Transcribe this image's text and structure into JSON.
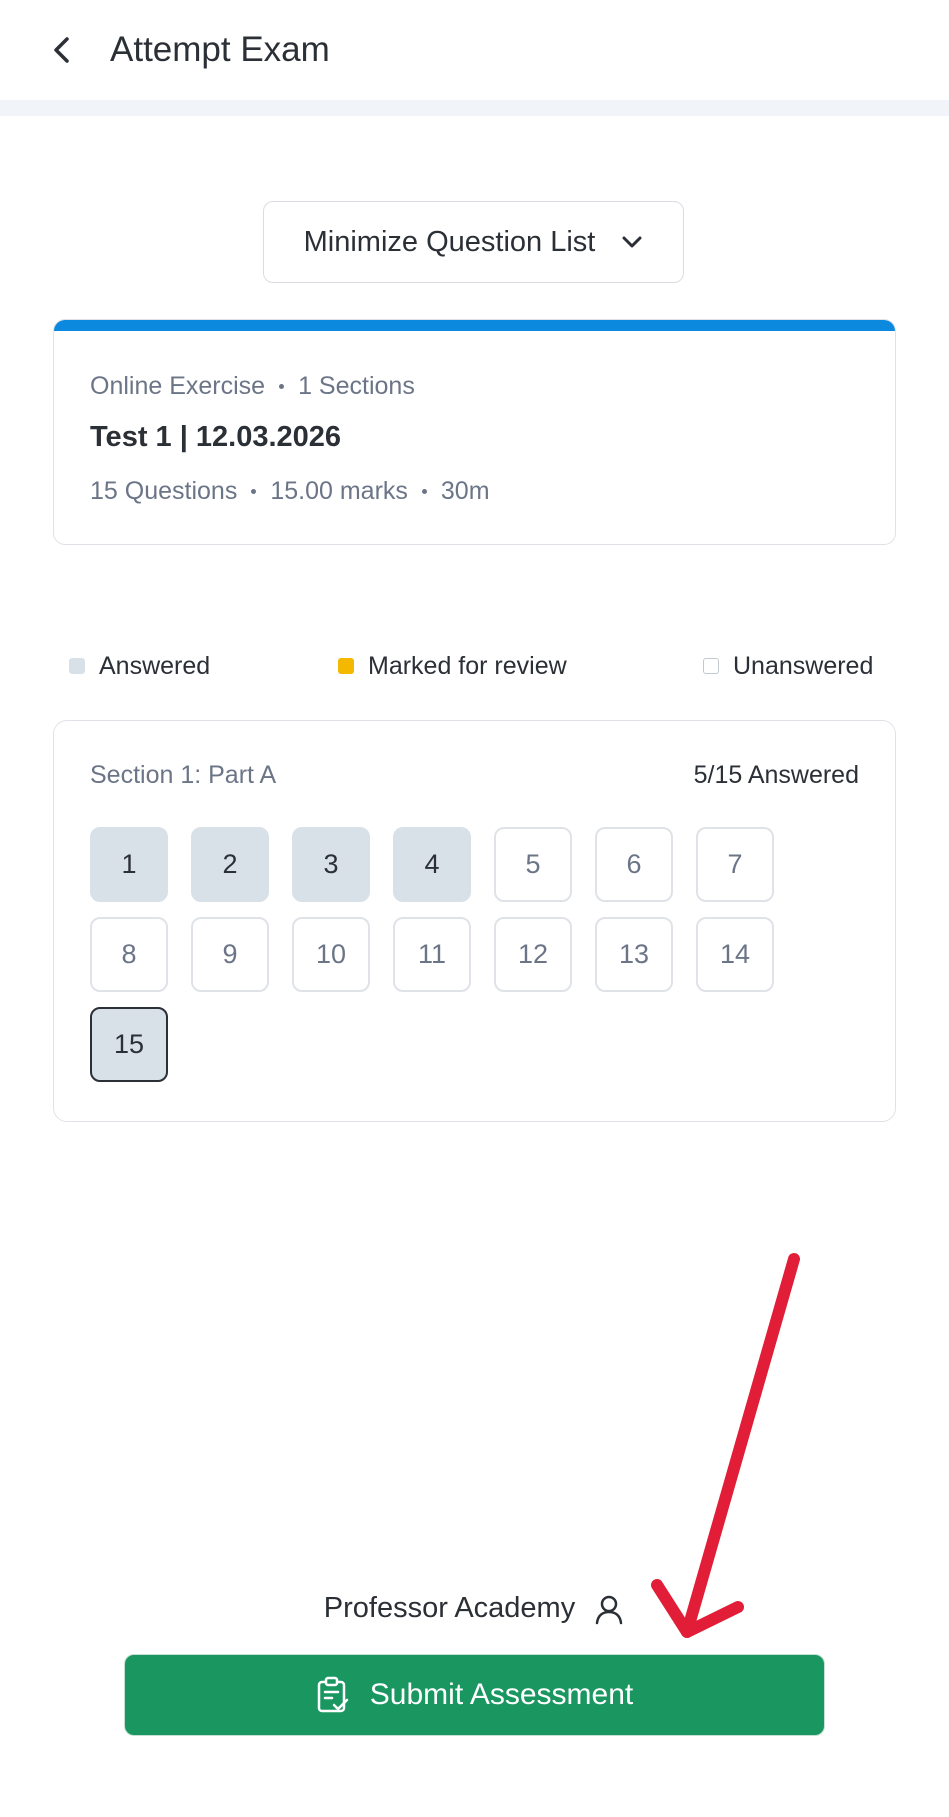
{
  "header": {
    "title": "Attempt Exam",
    "back_icon": "chevron-left-icon"
  },
  "toggle": {
    "label": "Minimize Question List",
    "icon": "chevron-down-icon"
  },
  "exam": {
    "type": "Online Exercise",
    "sections": "1 Sections",
    "title": "Test 1 | 12.03.2026",
    "questions": "15 Questions",
    "marks": "15.00 marks",
    "duration": "30m",
    "accent_color": "#0b89de"
  },
  "legend": {
    "answered": "Answered",
    "marked": "Marked for review",
    "unanswered": "Unanswered",
    "answered_color": "#d9e1e8",
    "marked_color": "#f5b800"
  },
  "section": {
    "name": "Section 1: Part A",
    "answered_count": "5/15 Answered",
    "questions": [
      {
        "num": "1",
        "state": "answered"
      },
      {
        "num": "2",
        "state": "answered"
      },
      {
        "num": "3",
        "state": "answered"
      },
      {
        "num": "4",
        "state": "answered"
      },
      {
        "num": "5",
        "state": "unanswered"
      },
      {
        "num": "6",
        "state": "unanswered"
      },
      {
        "num": "7",
        "state": "unanswered"
      },
      {
        "num": "8",
        "state": "unanswered"
      },
      {
        "num": "9",
        "state": "unanswered"
      },
      {
        "num": "10",
        "state": "unanswered"
      },
      {
        "num": "11",
        "state": "unanswered"
      },
      {
        "num": "12",
        "state": "unanswered"
      },
      {
        "num": "13",
        "state": "unanswered"
      },
      {
        "num": "14",
        "state": "unanswered"
      },
      {
        "num": "15",
        "state": "current"
      }
    ]
  },
  "footer": {
    "user_name": "Professor Academy",
    "user_icon": "user-icon",
    "submit_label": "Submit Assessment",
    "submit_icon": "clipboard-check-icon",
    "submit_color": "#1a9661",
    "annotation_color": "#e21d38"
  }
}
